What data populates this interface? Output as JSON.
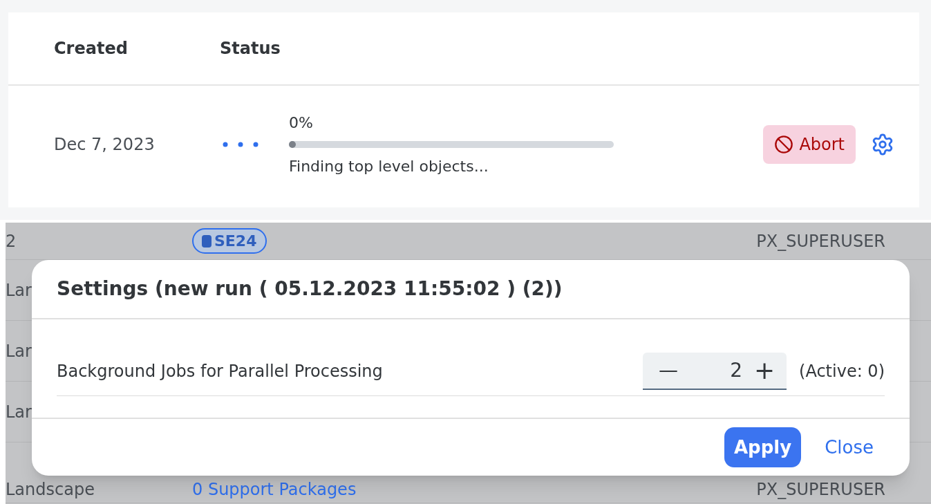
{
  "table": {
    "columns": [
      "Created",
      "Status"
    ],
    "rows": [
      {
        "created": "Dec 7, 2023",
        "percent": "0%",
        "level": 0,
        "message": "Finding top level objects...",
        "abort": "Abort"
      }
    ]
  },
  "background_table": {
    "rows": [
      {
        "column_1": "2",
        "tag": "SE24",
        "user": "PX_SUPERUSER"
      },
      {
        "column_1": "Lar"
      },
      {
        "column_1": "Lar"
      },
      {
        "column_1": "Lar"
      },
      {
        "column_1": "Landscape",
        "link": "0 Support Packages",
        "user": "PX_SUPERUSER"
      }
    ]
  },
  "dialog": {
    "title": "Settings (new run ( 05.12.2023 11:55:02 ) (2))",
    "field": {
      "label": "Background Jobs for Parallel Processing",
      "value": "2",
      "minus": "—",
      "plus": "+",
      "note": "(Active: 0)"
    },
    "buttons": [
      {
        "label": "Apply",
        "kind": "primary"
      },
      {
        "label": "Close",
        "kind": "link"
      }
    ]
  }
}
